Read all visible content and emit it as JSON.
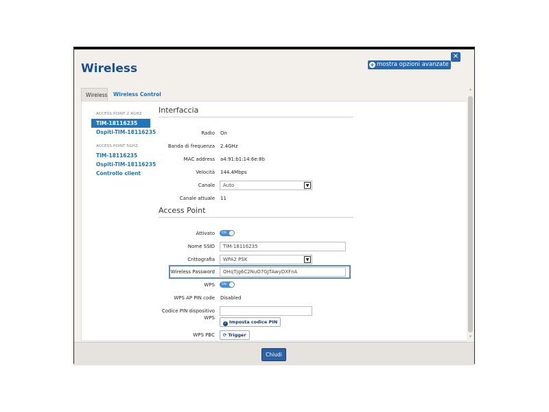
{
  "dialog": {
    "title": "Wireless",
    "advanced_label": "mostra opzioni avanzate",
    "close_glyph": "✕",
    "footer_button": "Chiudi"
  },
  "tabs": [
    {
      "label": "Wireless",
      "active": true
    },
    {
      "label": "Wireless Control",
      "active": false
    }
  ],
  "sidebar": {
    "group1_header": "ACCESS POINT 2.4GHZ",
    "group1_items": [
      "TIM-18116235",
      "Ospiti-TIM-18116235"
    ],
    "group2_header": "ACCESS POINT 5GHZ",
    "group2_items": [
      "TIM-18116235",
      "Ospiti-TIM-18116235",
      "Controllo client"
    ]
  },
  "interfaccia": {
    "title": "Interfaccia",
    "radio_label": "Radio",
    "radio_value": "On",
    "banda_label": "Banda di frequenza",
    "banda_value": "2.4GHz",
    "mac_label": "MAC address",
    "mac_value": "a4:91:b1:14:6e:8b",
    "velocita_label": "Velocità",
    "velocita_value": "144.4Mbps",
    "canale_label": "Canale",
    "canale_value": "Auto",
    "canale_attuale_label": "Canale attuale",
    "canale_attuale_value": "11"
  },
  "access_point": {
    "title": "Access Point",
    "attivato_label": "Attivato",
    "toggle_on_text": "ON",
    "ssid_label": "Nome SSID",
    "ssid_value": "TIM-18116235",
    "crittografia_label": "Crittografia",
    "crittografia_value": "WPA2 PSK",
    "password_label": "Wireless Password",
    "password_value": "OHqTjg6C2NuO7GJTAwyDXFnA",
    "wps_label": "WPS",
    "wps_pin_label": "WPS AP PIN code",
    "wps_pin_value": "Disabled",
    "codice_pin_label_1": "Codice PIN dispositivo",
    "codice_pin_label_2": "WPS",
    "codice_pin_value": "",
    "imposta_button": "Imposta codice PIN",
    "wps_pbc_label": "WPS PBC",
    "trigger_button": "Trigger"
  },
  "colors": {
    "accent": "#2b66ad",
    "link": "#1a73b8",
    "selected": "#1f76bd"
  }
}
